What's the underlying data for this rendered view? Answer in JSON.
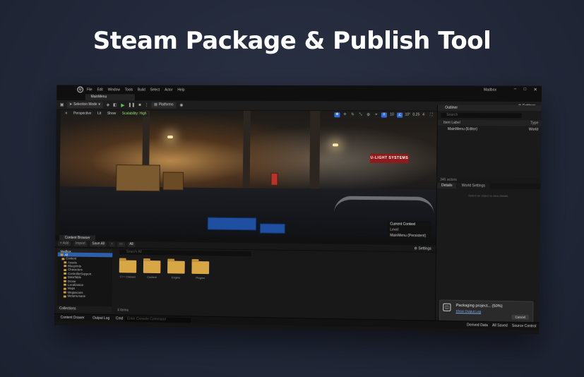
{
  "hero": {
    "title": "Steam Package & Publish Tool"
  },
  "window": {
    "logo": "U",
    "menu": [
      "File",
      "Edit",
      "Window",
      "Tools",
      "Build",
      "Select",
      "Actor",
      "Help"
    ],
    "app_name": "Madbox",
    "controls": [
      "–",
      "□",
      "✕"
    ]
  },
  "tabs": {
    "level": "MainMenu"
  },
  "toolbar": {
    "selection_mode": "Selection Mode",
    "platforms": "Platforms",
    "settings": "Settings"
  },
  "viewport": {
    "perspective": "Perspective",
    "lit": "Lit",
    "show": "Show",
    "scalability": "Scalability: High",
    "sign_text": "U-LIGHT SYSTEMS",
    "grid_value": "10",
    "angle_value": "10°",
    "scale_value": "0.25",
    "camera_speed": "4",
    "level_popup": {
      "title": "Current Context",
      "label": "Level",
      "value": "MainMenu (Persistent)"
    }
  },
  "outliner": {
    "tab": "Outliner",
    "search_placeholder": "Search",
    "col_label": "Item Label",
    "col_type": "Type",
    "row_label": "MainMenu (Editor)",
    "row_type": "World",
    "actors": "346 actors"
  },
  "details": {
    "tab_details": "Details",
    "tab_world": "World Settings",
    "empty_message": "Select an object to view details."
  },
  "toast": {
    "message": "Packaging project... (50%)",
    "link": "Show Output Log",
    "cancel": "Cancel"
  },
  "content_browser": {
    "tab": "Content Browser",
    "add": "+ Add",
    "import": "Import",
    "save_all": "Save All",
    "path_all": "All",
    "settings": "Settings",
    "search_placeholder": "Search All",
    "tree_root": "Madbox",
    "tree": [
      {
        "label": "All",
        "selected": true
      },
      {
        "label": "Content",
        "selected": false
      },
      {
        "label": "Assets",
        "selected": false
      },
      {
        "label": "Blueprints",
        "selected": false
      },
      {
        "label": "Characters",
        "selected": false
      },
      {
        "label": "ControllerSupport",
        "selected": false
      },
      {
        "label": "DataTable",
        "selected": false
      },
      {
        "label": "Drone",
        "selected": false
      },
      {
        "label": "Localization",
        "selected": false
      },
      {
        "label": "Maps",
        "selected": false
      },
      {
        "label": "Megascans",
        "selected": false
      },
      {
        "label": "MetaHumans",
        "selected": false
      }
    ],
    "folders": [
      "C++ Classes",
      "Content",
      "Engine",
      "Plugins"
    ],
    "collections": "Collections",
    "count": "4 items"
  },
  "statusbar": {
    "content_drawer": "Content Drawer",
    "output_log": "Output Log",
    "cmd": "Cmd",
    "console_placeholder": "Enter Console Command",
    "derived_data": "Derived Data",
    "all_saved": "All Saved",
    "source_control": "Source Control"
  },
  "colors": {
    "accent_blue": "#2f6bd8",
    "play_green": "#56c456",
    "folder": "#d9a646",
    "sign_red": "#8c1b1b"
  }
}
